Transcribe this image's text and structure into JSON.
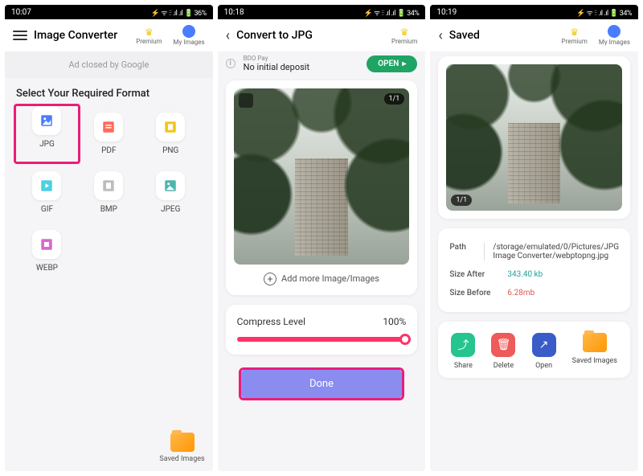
{
  "screen1": {
    "status": {
      "time": "10:07",
      "right": "⚡ ᯤ ⫶⫶ .ıl .ıl 🔋 36%"
    },
    "header": {
      "title": "Image Converter",
      "premium": "Premium",
      "myimages": "My Images"
    },
    "ad_text": "Ad closed by Google",
    "section_title": "Select Your Required Format",
    "formats": [
      {
        "label": "JPG",
        "color": "#4a7cff"
      },
      {
        "label": "PDF",
        "color": "#ff6b5a"
      },
      {
        "label": "PNG",
        "color": "#f5c518"
      },
      {
        "label": "GIF",
        "color": "#4dd0e1"
      },
      {
        "label": "BMP",
        "color": "#bdbdbd"
      },
      {
        "label": "JPEG",
        "color": "#4db6ac"
      },
      {
        "label": "WEBP",
        "color": "#d968d0"
      }
    ],
    "saved_images": "Saved Images"
  },
  "screen2": {
    "status": {
      "time": "10:18",
      "right": "⚡ ᯤ ⫶⫶ .ıl .ıl 🔋 34%"
    },
    "header": {
      "title": "Convert to JPG",
      "premium": "Premium"
    },
    "promo": {
      "sub": "BDO Pay",
      "text": "No initial deposit",
      "btn": "OPEN"
    },
    "count": "1/1",
    "add_more": "Add more Image/Images",
    "compress_label": "Compress Level",
    "compress_value": "100%",
    "done": "Done"
  },
  "screen3": {
    "status": {
      "time": "10:19",
      "right": "⚡ ᯤ ⫶⫶ .ıl .ıl 🔋 34%"
    },
    "header": {
      "title": "Saved",
      "premium": "Premium",
      "myimages": "My Images"
    },
    "count": "1/1",
    "info": {
      "path_label": "Path",
      "path_value": "/storage/emulated/0/Pictures/JPG Image Converter/webptopng.jpg",
      "size_after_label": "Size After",
      "size_after_value": "343.40 kb",
      "size_before_label": "Size Before",
      "size_before_value": "6.28mb"
    },
    "actions": {
      "share": "Share",
      "delete": "Delete",
      "open": "Open",
      "saved": "Saved Images"
    }
  }
}
